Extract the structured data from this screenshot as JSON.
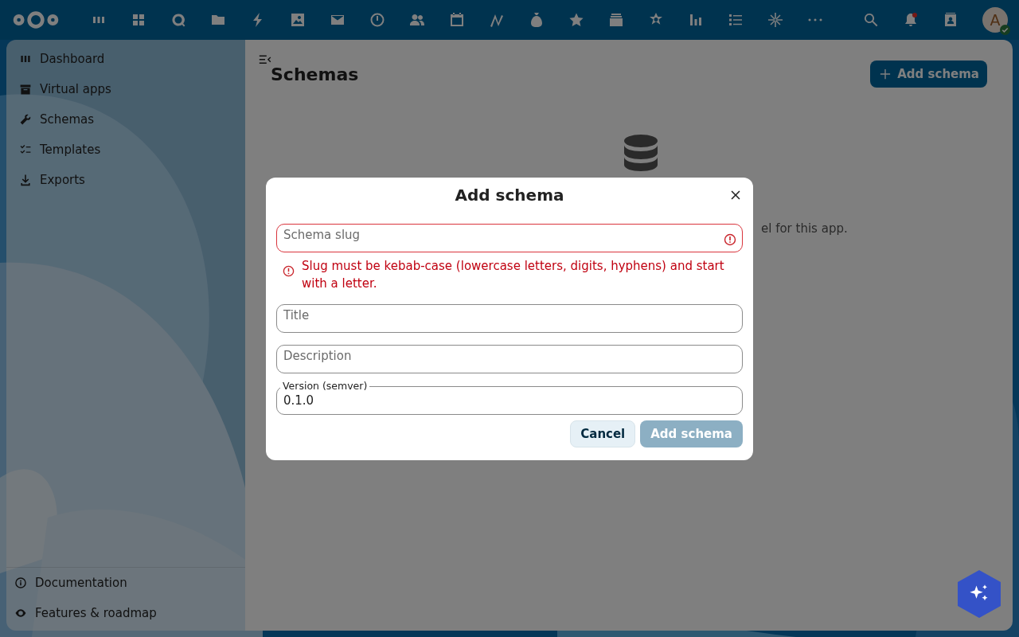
{
  "header": {
    "avatar": {
      "letter": "A",
      "online": true
    },
    "notifications": {
      "unread": true
    }
  },
  "sidebar": {
    "items": [
      {
        "label": "Dashboard"
      },
      {
        "label": "Virtual apps"
      },
      {
        "label": "Schemas"
      },
      {
        "label": "Templates"
      },
      {
        "label": "Exports"
      }
    ],
    "footer_items": [
      {
        "label": "Documentation"
      },
      {
        "label": "Features & roadmap"
      }
    ]
  },
  "page": {
    "title": "Schemas",
    "add_button": "Add schema",
    "empty_text": "el for this app."
  },
  "dialog": {
    "title": "Add schema",
    "fields": [
      {
        "label": "Schema slug",
        "error": true,
        "error_message": "Slug must be kebab-case (lowercase letters, digits, hyphens) and start with a letter."
      },
      {
        "label": "Title",
        "error": false
      },
      {
        "label": "Description",
        "error": false
      },
      {
        "label": "Version (semver)",
        "value": "0.1.0",
        "error": false
      }
    ],
    "buttons": [
      {
        "label": "Cancel",
        "kind": "secondary",
        "disabled": false
      },
      {
        "label": "Add schema",
        "kind": "primary",
        "disabled": true
      }
    ]
  }
}
